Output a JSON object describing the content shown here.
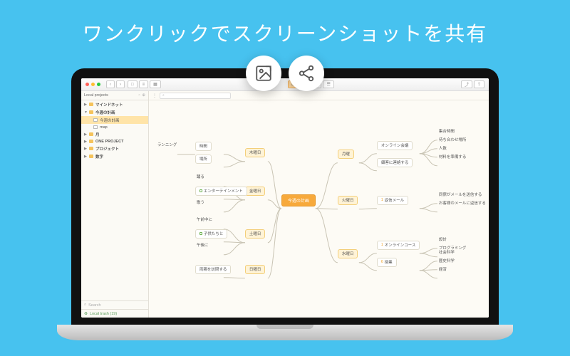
{
  "hero": "ワンクリックでスクリーンショットを共有",
  "float_icons": {
    "image": "image-icon",
    "share": "share-icon"
  },
  "sidebar": {
    "header": "Local projects",
    "items": [
      {
        "label": "マインドネット",
        "level": 1,
        "kind": "folder",
        "open": false
      },
      {
        "label": "今週の計画",
        "level": 1,
        "kind": "folder",
        "open": true
      },
      {
        "label": "今週の計画",
        "level": 2,
        "kind": "doc",
        "selected": true
      },
      {
        "label": "map",
        "level": 2,
        "kind": "doc"
      },
      {
        "label": "月",
        "level": 1,
        "kind": "folder",
        "open": false
      },
      {
        "label": "ONE PROJECT",
        "level": 1,
        "kind": "folder",
        "open": false
      },
      {
        "label": "プロジェクト",
        "level": 1,
        "kind": "folder",
        "open": false
      },
      {
        "label": "数字",
        "level": 1,
        "kind": "folder",
        "open": false
      }
    ],
    "search_placeholder": "Search",
    "trash_label": "Local trash (19)"
  },
  "toolbar": {
    "nav_back": "‹",
    "nav_fwd": "›",
    "group_a": [
      "□",
      "≡",
      "▦"
    ],
    "group_b": [
      "⊞",
      "⊡",
      "−",
      "☰"
    ],
    "group_c": [
      "⤴",
      "⇪"
    ]
  },
  "mindmap": {
    "center": "今週の計画",
    "left": [
      {
        "day": "木曜日",
        "children": [
          {
            "label": "時間",
            "children": [
              {
                "label": "ランニング",
                "check": true
              }
            ]
          },
          {
            "label": "場所"
          }
        ]
      },
      {
        "day": "金曜日",
        "children": [
          {
            "label": "踊る",
            "plain": true
          },
          {
            "label": "エンターテインメント",
            "check": true,
            "children": []
          },
          {
            "label": "歌う",
            "plain": true
          }
        ]
      },
      {
        "day": "土曜日",
        "children": [
          {
            "label": "午前中に",
            "plain": true
          },
          {
            "label": "子供たちと",
            "check": true
          },
          {
            "label": "午後に",
            "plain": true
          }
        ]
      },
      {
        "day": "日曜日",
        "children": [
          {
            "label": "両親を訪問する"
          }
        ]
      }
    ],
    "right": [
      {
        "day": "月曜",
        "children": [
          {
            "label": "オンライン会議",
            "side": [
              {
                "label": "集合時間"
              },
              {
                "label": "待ち合わせ場所"
              },
              {
                "label": "人数"
              },
              {
                "label": "材料を準備する"
              }
            ]
          },
          {
            "label": "顧客に連絡する"
          }
        ]
      },
      {
        "day": "火曜日",
        "children": [
          {
            "label": "返信メール",
            "num": "1",
            "side": [
              {
                "label": "同僚がメールを送信する"
              },
              {
                "label": "お客様のメールに返信する"
              }
            ]
          }
        ]
      },
      {
        "day": "水曜日",
        "children": [
          {
            "label": "オンラインコース",
            "num": "1",
            "side": [
              {
                "label": "設計"
              },
              {
                "label": "プログラミング"
              }
            ]
          },
          {
            "label": "授業",
            "num": "6",
            "side": [
              {
                "label": "社会科学"
              },
              {
                "label": "歴史科学"
              },
              {
                "label": "経済"
              }
            ]
          }
        ]
      }
    ]
  }
}
